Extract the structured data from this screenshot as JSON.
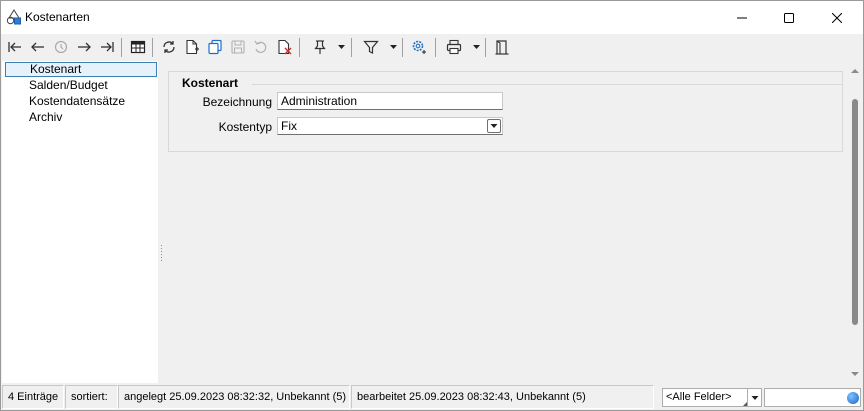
{
  "window": {
    "title": "Kostenarten",
    "icon": "shapes-app-icon",
    "controls": [
      "minimize-icon",
      "maximize-icon",
      "close-icon"
    ]
  },
  "toolbar": {
    "buttons": [
      "first-record-icon",
      "previous-record-icon",
      "history-icon",
      "next-record-icon",
      "last-record-icon",
      "table-view-icon",
      "refresh-icon",
      "new-record-icon",
      "copy-record-icon",
      "save-icon",
      "undo-icon",
      "delete-record-icon",
      "pin-icon",
      "filter-icon",
      "settings-icon",
      "print-icon",
      "exit-icon"
    ]
  },
  "tree": {
    "items": [
      {
        "label": "Kostenart",
        "selected": true
      },
      {
        "label": "Salden/Budget",
        "selected": false
      },
      {
        "label": "Kostendatensätze",
        "selected": false
      },
      {
        "label": "Archiv",
        "selected": false
      }
    ]
  },
  "form": {
    "group_title": "Kostenart",
    "fields": {
      "bezeichnung": {
        "label": "Bezeichnung",
        "value": "Administration"
      },
      "kostentyp": {
        "label": "Kostentyp",
        "value": "Fix"
      }
    }
  },
  "status": {
    "count": "4 Einträge",
    "sort": "sortiert:",
    "created": "angelegt 25.09.2023 08:32:32, Unbekannt (5)",
    "edited": "bearbeitet 25.09.2023 08:32:43, Unbekannt (5)",
    "field_filter": "<Alle Felder>",
    "search_value": ""
  },
  "colors": {
    "selection_border": "#3c7fb1",
    "selection_fill": "#e5f1fb",
    "accent_blue": "#1e6fc4"
  }
}
